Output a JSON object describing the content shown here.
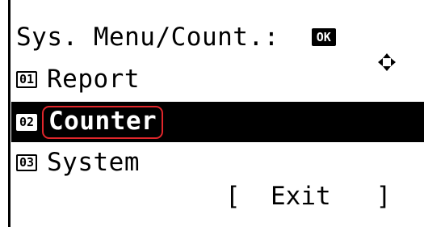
{
  "header": {
    "title": "Sys. Menu/Count.:",
    "nav_icon": "four-way-arrow-icon",
    "ok_label": "OK"
  },
  "menu": {
    "items": [
      {
        "number": "01",
        "label": "Report",
        "selected": false
      },
      {
        "number": "02",
        "label": "Counter",
        "selected": true
      },
      {
        "number": "03",
        "label": "System",
        "selected": false
      }
    ]
  },
  "footer": {
    "exit_label": "[  Exit   ]"
  },
  "colors": {
    "selection_bg": "#000000",
    "highlight_outline": "#e0262b"
  }
}
